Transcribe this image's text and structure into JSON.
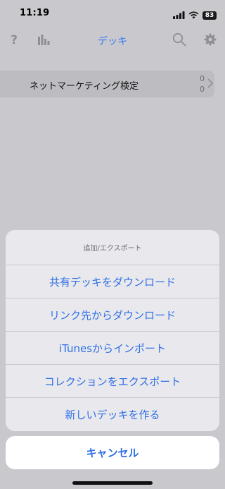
{
  "status_bar": {
    "time": "11:19",
    "battery": "83"
  },
  "nav": {
    "title": "デッキ"
  },
  "deck": {
    "name": "ネットマーケティング検定",
    "count_new": "0",
    "count_due": "0"
  },
  "sheet": {
    "title": "追加/エクスポート",
    "items": [
      {
        "label": "共有デッキをダウンロード"
      },
      {
        "label": "リンク先からダウンロード"
      },
      {
        "label": "iTunesからインポート"
      },
      {
        "label": "コレクションをエクスポート"
      },
      {
        "label": "新しいデッキを作る"
      }
    ],
    "cancel_label": "キャンセル"
  },
  "colors": {
    "accent": "#2f6fe4",
    "nav_title": "#3478f6"
  }
}
